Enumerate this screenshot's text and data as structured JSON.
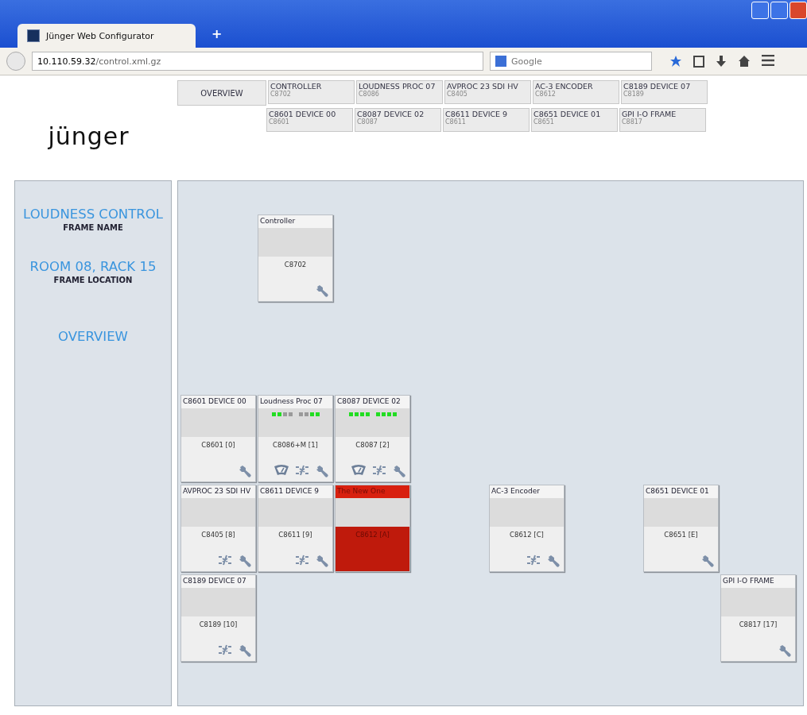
{
  "browser": {
    "tab_title": "Jünger Web Configurator",
    "new_tab": "+",
    "url_host": "10.110.59.32",
    "url_path": "/control.xml.gz",
    "search_placeholder": "Google"
  },
  "header": {
    "logo": "jünger",
    "nav_rows": [
      [
        {
          "kind": "main",
          "label": "OVERVIEW"
        },
        {
          "kind": "device",
          "label": "CONTROLLER",
          "code": "C8702"
        },
        {
          "kind": "device",
          "label": "LOUDNESS PROC 07",
          "code": "C8086"
        },
        {
          "kind": "device",
          "label": "AVPROC 23 SDI HV",
          "code": "C8405"
        },
        {
          "kind": "device",
          "label": "AC-3 ENCODER",
          "code": "C8612"
        },
        {
          "kind": "device",
          "label": "C8189 DEVICE 07",
          "code": "C8189"
        }
      ],
      [
        {
          "kind": "empty"
        },
        {
          "kind": "device",
          "label": "C8601 DEVICE 00",
          "code": "C8601"
        },
        {
          "kind": "device",
          "label": "C8087 DEVICE 02",
          "code": "C8087"
        },
        {
          "kind": "device",
          "label": "C8611 DEVICE 9",
          "code": "C8611"
        },
        {
          "kind": "device",
          "label": "C8651 DEVICE 01",
          "code": "C8651"
        },
        {
          "kind": "device",
          "label": "GPI I-O FRAME",
          "code": "C8817"
        }
      ]
    ]
  },
  "sidebar": {
    "frame_name": "LOUDNESS CONTROL",
    "frame_name_label": "FRAME NAME",
    "frame_location": "ROOM 08, RACK 15",
    "frame_location_label": "FRAME LOCATION",
    "link": "OVERVIEW"
  },
  "canvas": {
    "controller_row": [
      {
        "kind": "empty"
      },
      {
        "kind": "card",
        "title": "Controller",
        "address": "C8702",
        "alarm": false,
        "icons": [
          {
            "kind": "wrench"
          }
        ]
      }
    ],
    "rows": [
      [
        {
          "kind": "card",
          "title": "C8601 DEVICE 00",
          "address": "C8601 [0]",
          "alarm": false,
          "icons": [
            {
              "kind": "wrench"
            }
          ]
        },
        {
          "kind": "card",
          "title": "Loudness Proc 07",
          "address": "C8086+M [1]",
          "alarm": false,
          "meters": [
            {
              "leds": [
                {
                  "on": true
                },
                {
                  "on": true
                },
                {
                  "on": false
                },
                {
                  "on": false
                }
              ]
            },
            {
              "leds": [
                {
                  "on": false
                },
                {
                  "on": false
                },
                {
                  "on": true
                },
                {
                  "on": true
                }
              ]
            }
          ],
          "icons": [
            {
              "kind": "meter"
            },
            {
              "kind": "network"
            },
            {
              "kind": "wrench"
            }
          ]
        },
        {
          "kind": "card",
          "title": "C8087 DEVICE 02",
          "address": "C8087 [2]",
          "alarm": false,
          "meters": [
            {
              "leds": [
                {
                  "on": true
                },
                {
                  "on": true
                },
                {
                  "on": true
                },
                {
                  "on": true
                }
              ]
            },
            {
              "leds": [
                {
                  "on": true
                },
                {
                  "on": true
                },
                {
                  "on": true
                },
                {
                  "on": true
                }
              ]
            }
          ],
          "icons": [
            {
              "kind": "meter"
            },
            {
              "kind": "network"
            },
            {
              "kind": "wrench"
            }
          ]
        }
      ],
      [
        {
          "kind": "card",
          "title": "AVPROC 23 SDI HV",
          "address": "C8405 [8]",
          "alarm": false,
          "icons": [
            {
              "kind": "network"
            },
            {
              "kind": "wrench"
            }
          ]
        },
        {
          "kind": "card",
          "title": "C8611 DEVICE 9",
          "address": "C8611 [9]",
          "alarm": false,
          "icons": [
            {
              "kind": "network"
            },
            {
              "kind": "wrench"
            }
          ]
        },
        {
          "kind": "card",
          "title": "The New One",
          "address": "C8612 [A]",
          "alarm": true
        },
        {
          "kind": "empty"
        },
        {
          "kind": "card",
          "title": "AC-3 Encoder",
          "address": "C8612 [C]",
          "alarm": false,
          "icons": [
            {
              "kind": "network"
            },
            {
              "kind": "wrench"
            }
          ]
        },
        {
          "kind": "empty"
        },
        {
          "kind": "card",
          "title": "C8651 DEVICE 01",
          "address": "C8651 [E]",
          "alarm": false,
          "icons": [
            {
              "kind": "wrench"
            }
          ]
        }
      ],
      [
        {
          "kind": "card",
          "title": "C8189 DEVICE 07",
          "address": "C8189 [10]",
          "alarm": false,
          "icons": [
            {
              "kind": "network"
            },
            {
              "kind": "wrench"
            }
          ]
        },
        {
          "kind": "empty"
        },
        {
          "kind": "empty"
        },
        {
          "kind": "empty"
        },
        {
          "kind": "empty"
        },
        {
          "kind": "empty"
        },
        {
          "kind": "empty"
        },
        {
          "kind": "card",
          "title": "GPI I-O FRAME",
          "address": "C8817 [17]",
          "alarm": false,
          "icons": [
            {
              "kind": "wrench"
            }
          ]
        }
      ]
    ]
  }
}
